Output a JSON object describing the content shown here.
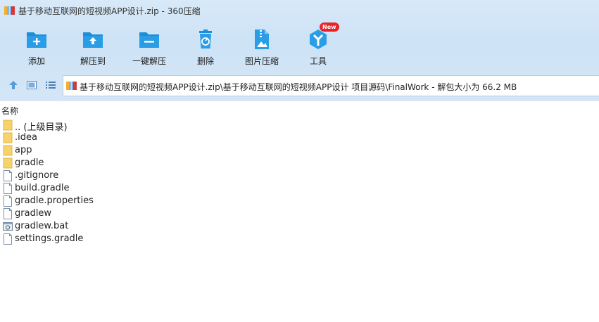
{
  "window": {
    "title": "基于移动互联网的短视频APP设计.zip - 360压缩"
  },
  "toolbar": {
    "items": [
      {
        "label": "添加",
        "icon": "add-folder-icon"
      },
      {
        "label": "解压到",
        "icon": "extract-to-icon"
      },
      {
        "label": "一键解压",
        "icon": "one-click-extract-icon"
      },
      {
        "label": "删除",
        "icon": "recycle-bin-icon"
      },
      {
        "label": "图片压缩",
        "icon": "image-compress-icon"
      },
      {
        "label": "工具",
        "icon": "tools-icon",
        "badge": "New"
      }
    ]
  },
  "nav": {
    "path": "基于移动互联网的短视频APP设计.zip\\基于移动互联网的短视频APP设计 项目源码\\FinalWork - 解包大小为 66.2 MB"
  },
  "columns": {
    "name": "名称"
  },
  "files": [
    {
      "name": ".. (上级目录)",
      "type": "folder"
    },
    {
      "name": ".idea",
      "type": "folder"
    },
    {
      "name": "app",
      "type": "folder"
    },
    {
      "name": "gradle",
      "type": "folder"
    },
    {
      "name": ".gitignore",
      "type": "file"
    },
    {
      "name": "build.gradle",
      "type": "file"
    },
    {
      "name": "gradle.properties",
      "type": "file"
    },
    {
      "name": "gradlew",
      "type": "file"
    },
    {
      "name": "gradlew.bat",
      "type": "bat"
    },
    {
      "name": "settings.gradle",
      "type": "file"
    }
  ],
  "colors": {
    "accent": "#1a8fd8",
    "chrome": "#d3e6f7",
    "folder": "#f6d36b",
    "badge": "#e8242b"
  }
}
